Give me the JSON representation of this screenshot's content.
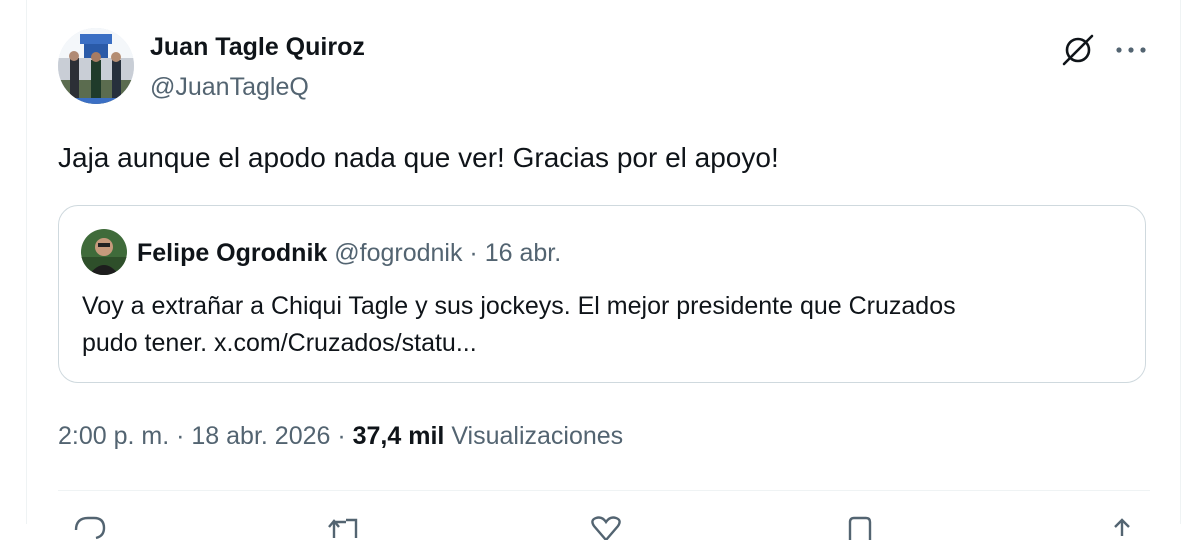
{
  "author": {
    "display_name": "Juan Tagle Quiroz",
    "handle": "@JuanTagleQ"
  },
  "header_icons": [
    "grok-icon",
    "more-options-icon"
  ],
  "tweet": {
    "text": "Jaja aunque el apodo nada que ver! Gracias por el apoyo!"
  },
  "quoted_tweet": {
    "display_name": "Felipe Ogrodnik",
    "handle": "@fogrodnik",
    "separator": " · ",
    "date": "16 abr.",
    "text_line1": "Voy a extrañar a Chiqui Tagle y sus jockeys. El mejor presidente que Cruzados",
    "text_line2": "pudo tener. x.com/Cruzados/statu..."
  },
  "meta": {
    "time": "2:00 p. m.",
    "sep1": " · ",
    "date": "18 abr. 2026",
    "sep2": " · ",
    "views_count": "37,4 mil",
    "views_label": "Visualizaciones"
  },
  "actions": [
    "reply-icon",
    "repost-icon",
    "like-icon",
    "bookmark-icon",
    "share-icon"
  ],
  "colors": {
    "text_primary": "#0f1419",
    "text_secondary": "#536471",
    "border": "#cfd9de",
    "divider": "#eff3f4"
  }
}
